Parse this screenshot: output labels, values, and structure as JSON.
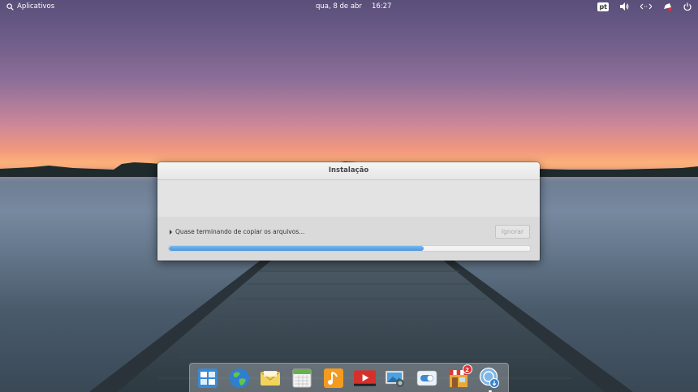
{
  "panel": {
    "apps_label": "Aplicativos",
    "date": "qua, 8 de abr",
    "time": "16:27",
    "language": "pt",
    "indicators": [
      "keyboard-layout-icon",
      "volume-icon",
      "network-icon",
      "notifications-icon",
      "power-icon"
    ]
  },
  "installer": {
    "title": "Instalação",
    "status": "Quase terminando de copiar os arquivos...",
    "ignore_label": "Ignorar",
    "progress": 0.705
  },
  "dock": {
    "items": [
      {
        "name": "multitasking-view",
        "icon": "windows-grid-icon"
      },
      {
        "name": "web-browser",
        "icon": "globe-icon"
      },
      {
        "name": "mail",
        "icon": "envelope-icon"
      },
      {
        "name": "calendar",
        "icon": "calendar-icon"
      },
      {
        "name": "music",
        "icon": "music-note-icon"
      },
      {
        "name": "videos",
        "icon": "play-icon"
      },
      {
        "name": "photos",
        "icon": "camera-photo-icon"
      },
      {
        "name": "system-settings",
        "icon": "toggle-switch-icon"
      },
      {
        "name": "appcenter",
        "icon": "store-icon",
        "badge": "2"
      },
      {
        "name": "installer",
        "icon": "installer-download-icon"
      }
    ]
  },
  "colors": {
    "accent": "#4b95de",
    "badge": "#e0302e"
  }
}
